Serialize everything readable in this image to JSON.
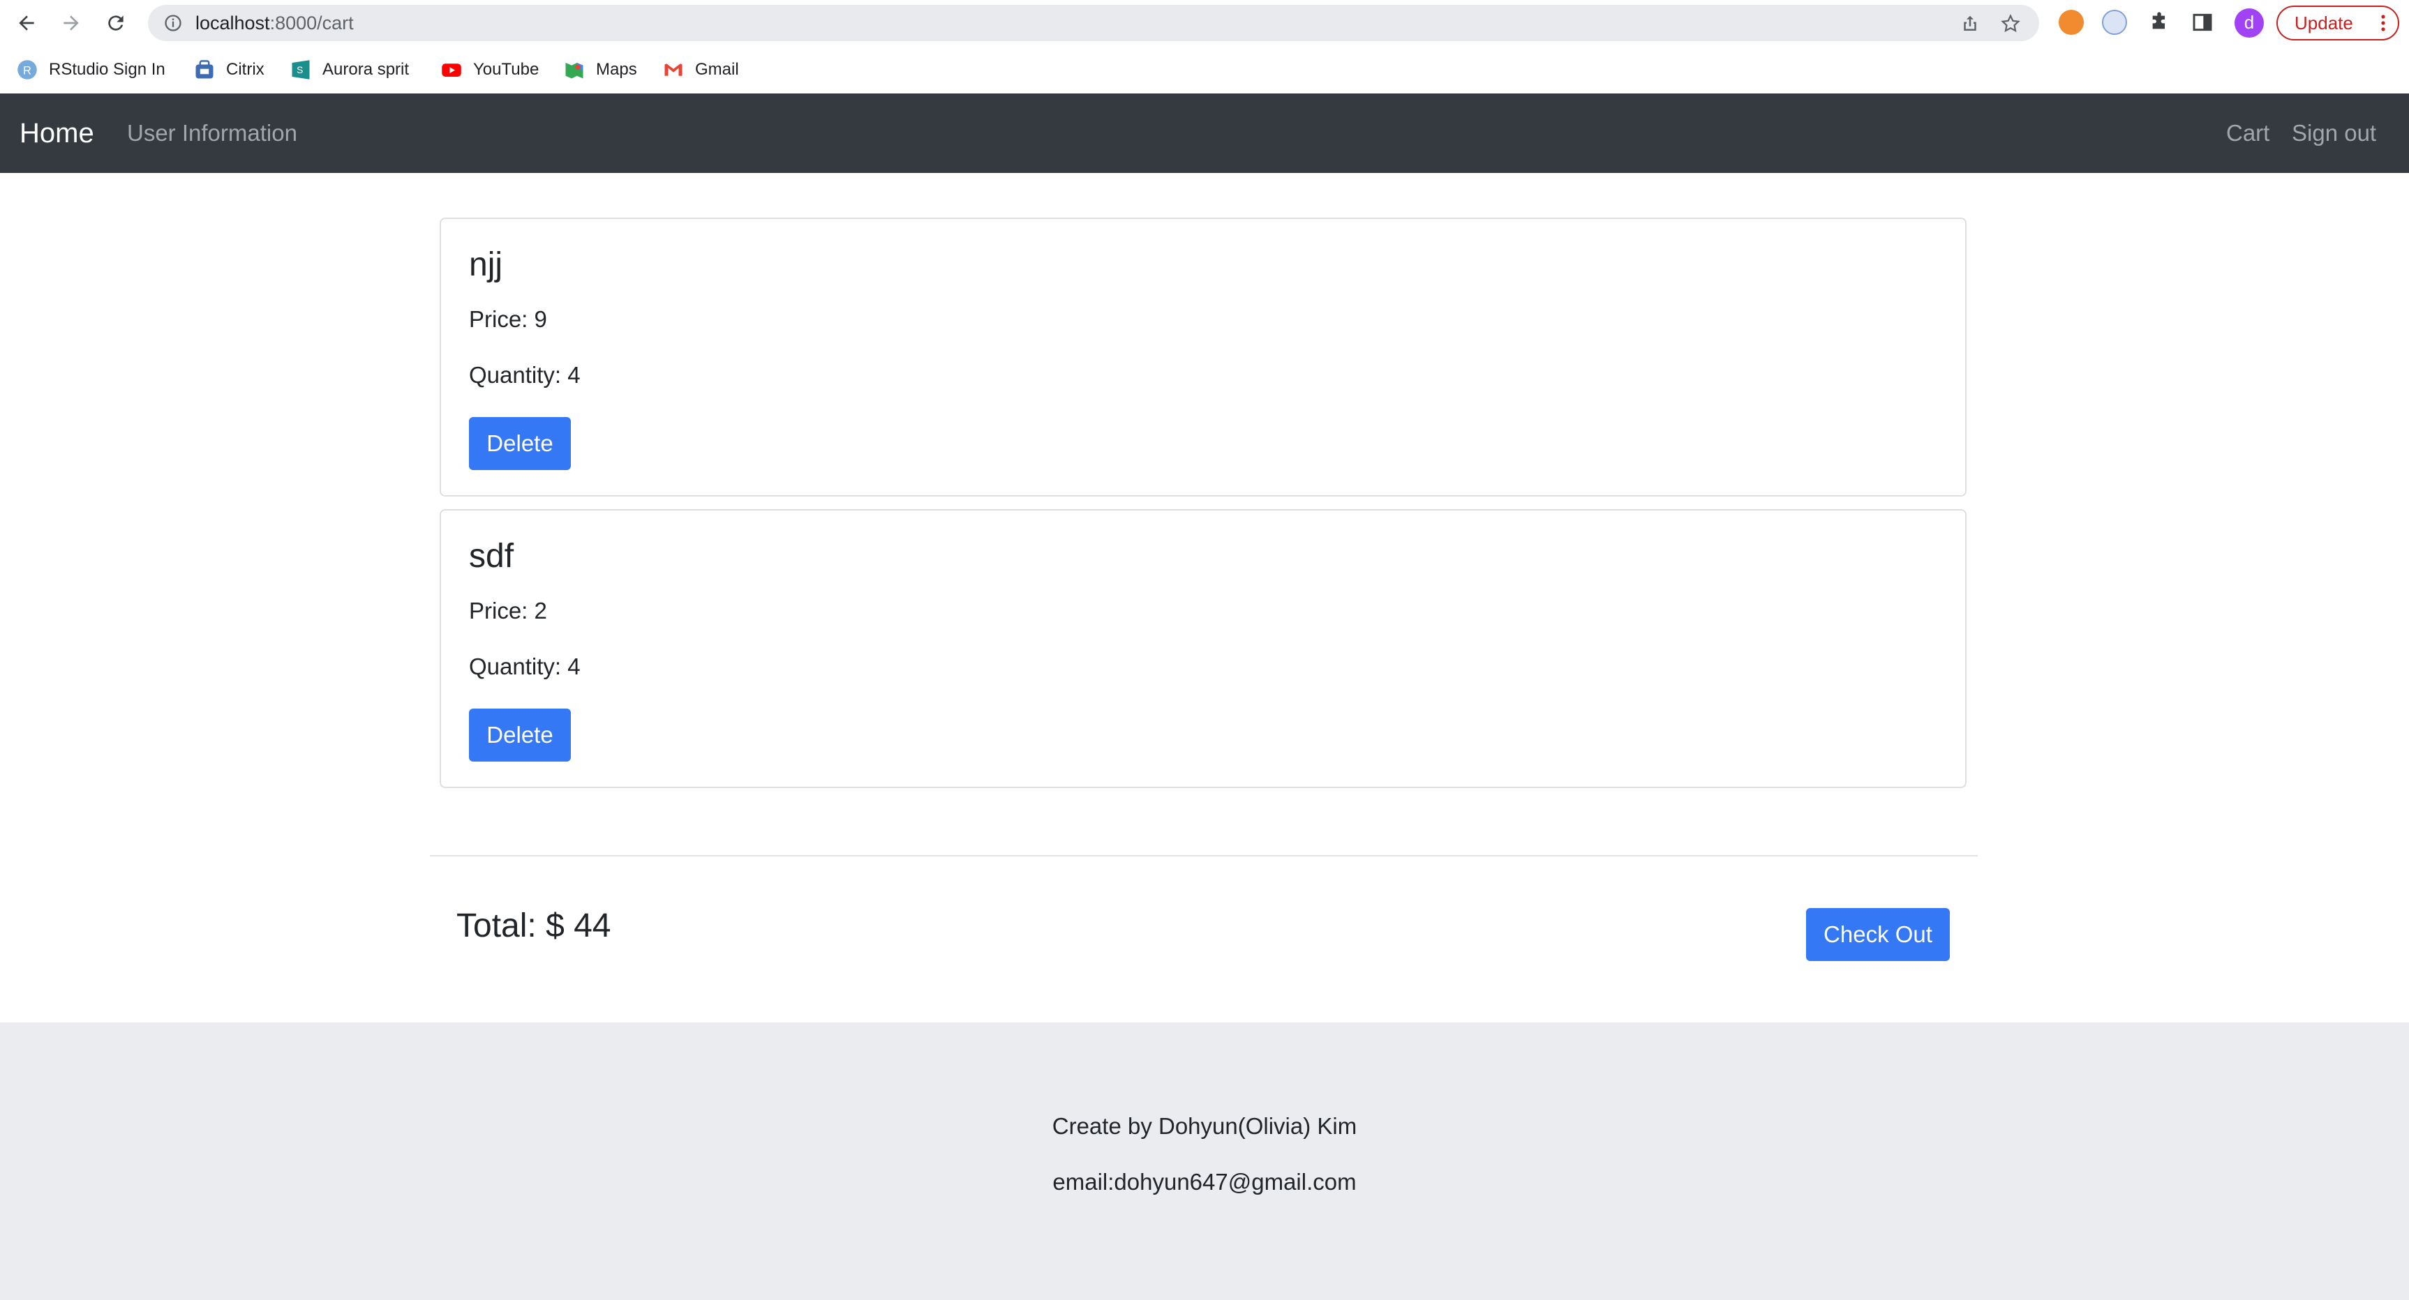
{
  "browser": {
    "url": "localhost:8000/cart",
    "url_host": "localhost",
    "url_rest": ":8000/cart",
    "update_label": "Update",
    "profile_initial": "d",
    "bookmarks": [
      {
        "label": "RStudio Sign In",
        "icon": "rstudio-icon",
        "color": "#75aadb"
      },
      {
        "label": "Citrix",
        "icon": "citrix-icon",
        "color": "#3f6bb4"
      },
      {
        "label": "Aurora sprit",
        "icon": "aurora-icon",
        "color": "#1b8e8e"
      },
      {
        "label": "YouTube",
        "icon": "youtube-icon",
        "color": "#ff0000"
      },
      {
        "label": "Maps",
        "icon": "maps-icon",
        "color": "#34a853"
      },
      {
        "label": "Gmail",
        "icon": "gmail-icon",
        "color": "#ea4335"
      }
    ]
  },
  "navbar": {
    "brand": "Home",
    "left_links": [
      "User Information"
    ],
    "right_links": [
      "Cart",
      "Sign out"
    ],
    "background": "#343a40"
  },
  "cart": {
    "items": [
      {
        "name": "njj",
        "price_label": "Price: 9",
        "quantity_label": "Quantity: 4",
        "delete_label": "Delete"
      },
      {
        "name": "sdf",
        "price_label": "Price: 2",
        "quantity_label": "Quantity: 4",
        "delete_label": "Delete"
      }
    ],
    "total_label": "Total: $ 44",
    "checkout_label": "Check Out",
    "accent": "#3478f6"
  },
  "footer": {
    "credit": "Create by Dohyun(Olivia) Kim",
    "email": "email:dohyun647@gmail.com",
    "background": "#ebecf0"
  }
}
